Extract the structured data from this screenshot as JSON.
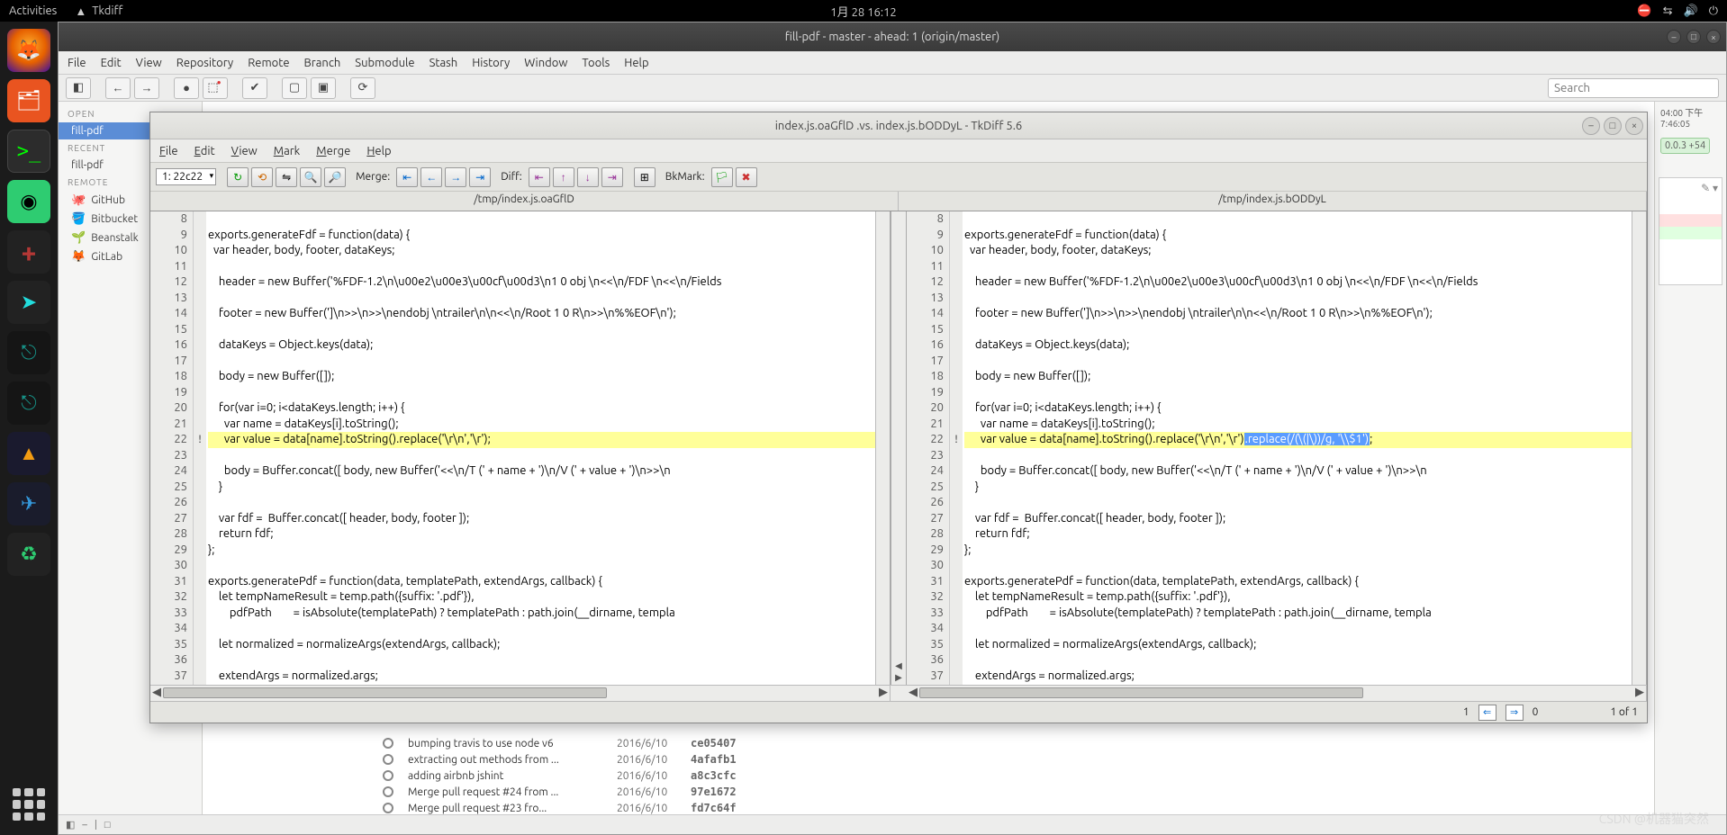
{
  "gnome": {
    "activities": "Activities",
    "app_name": "Tkdiff",
    "clock": "1月 28 16:12"
  },
  "git_window": {
    "title": "fill-pdf - master - ahead: 1 (origin/master)",
    "menus": [
      "File",
      "Edit",
      "View",
      "Repository",
      "Remote",
      "Branch",
      "Submodule",
      "Stash",
      "History",
      "Window",
      "Tools",
      "Help"
    ],
    "search_placeholder": "Search",
    "sidebar": {
      "sections": {
        "open": "OPEN",
        "recent": "RECENT",
        "remote": "REMOTE"
      },
      "open_items": [
        "fill-pdf"
      ],
      "recent_items": [
        "fill-pdf"
      ],
      "remote_items": [
        "GitHub",
        "Bitbucket",
        "Beanstalk",
        "GitLab"
      ]
    },
    "right": {
      "time": "04:00 下午7:46:05",
      "badge": "0.0.3 +54"
    },
    "commits": [
      {
        "msg": "bumping travis to use node v6",
        "date": "2016/6/10",
        "sha": "ce05407"
      },
      {
        "msg": "extracting out methods from ...",
        "date": "2016/6/10",
        "sha": "4afafb1"
      },
      {
        "msg": "adding airbnb jshint",
        "date": "2016/6/10",
        "sha": "a8c3cfc"
      },
      {
        "msg": "Merge pull request #24 from ...",
        "date": "2016/6/10",
        "sha": "97e1672"
      },
      {
        "msg": "Merge pull request #23 fro...",
        "date": "2016/6/10",
        "sha": "fd7c64f"
      }
    ]
  },
  "tkdiff": {
    "title": "index.js.oaGflD .vs. index.js.bODDyL - TkDiff 5.6",
    "menus": [
      "File",
      "Edit",
      "View",
      "Mark",
      "Merge",
      "Help"
    ],
    "change_selector": "1: 22c22",
    "toolbar_labels": {
      "merge": "Merge:",
      "diff": "Diff:",
      "bkmark": "BkMark:"
    },
    "left_path": "/tmp/index.js.oaGflD",
    "right_path": "/tmp/index.js.bODDyL",
    "left_lines": [
      {
        "n": 8,
        "t": ""
      },
      {
        "n": 9,
        "t": "exports.generateFdf = function(data) {"
      },
      {
        "n": 10,
        "t": "  var header, body, footer, dataKeys;"
      },
      {
        "n": 11,
        "t": ""
      },
      {
        "n": 12,
        "t": "    header = new Buffer('%FDF-1.2\\n\\u00e2\\u00e3\\u00cf\\u00d3\\n1 0 obj \\n<<\\n/FDF \\n<<\\n/Fields"
      },
      {
        "n": 13,
        "t": ""
      },
      {
        "n": 14,
        "t": "    footer = new Buffer(']\\n>>\\n>>\\nendobj \\ntrailer\\n\\n<<\\n/Root 1 0 R\\n>>\\n%%EOF\\n');"
      },
      {
        "n": 15,
        "t": ""
      },
      {
        "n": 16,
        "t": "    dataKeys = Object.keys(data);"
      },
      {
        "n": 17,
        "t": ""
      },
      {
        "n": 18,
        "t": "    body = new Buffer([]);"
      },
      {
        "n": 19,
        "t": ""
      },
      {
        "n": 20,
        "t": "    for(var i=0; i<dataKeys.length; i++) {"
      },
      {
        "n": 21,
        "t": "      var name = dataKeys[i].toString();"
      },
      {
        "n": 22,
        "t": "      var value = data[name].toString().replace('\\r\\n','\\r');",
        "chg": true
      },
      {
        "n": 23,
        "t": ""
      },
      {
        "n": 24,
        "t": "      body = Buffer.concat([ body, new Buffer('<<\\n/T (' + name + ')\\n/V (' + value + ')\\n>>\\n"
      },
      {
        "n": 25,
        "t": "    }"
      },
      {
        "n": 26,
        "t": ""
      },
      {
        "n": 27,
        "t": "    var fdf =  Buffer.concat([ header, body, footer ]);"
      },
      {
        "n": 28,
        "t": "    return fdf;"
      },
      {
        "n": 29,
        "t": "};"
      },
      {
        "n": 30,
        "t": ""
      },
      {
        "n": 31,
        "t": "exports.generatePdf = function(data, templatePath, extendArgs, callback) {"
      },
      {
        "n": 32,
        "t": "    let tempNameResult = temp.path({suffix: '.pdf'}),"
      },
      {
        "n": 33,
        "t": "        pdfPath        = isAbsolute(templatePath) ? templatePath : path.join(__dirname, templa"
      },
      {
        "n": 34,
        "t": ""
      },
      {
        "n": 35,
        "t": "    let normalized = normalizeArgs(extendArgs, callback);"
      },
      {
        "n": 36,
        "t": ""
      },
      {
        "n": 37,
        "t": "    extendArgs = normalized.args;"
      }
    ],
    "right_lines": [
      {
        "n": 8,
        "t": ""
      },
      {
        "n": 9,
        "t": "exports.generateFdf = function(data) {"
      },
      {
        "n": 10,
        "t": "  var header, body, footer, dataKeys;"
      },
      {
        "n": 11,
        "t": ""
      },
      {
        "n": 12,
        "t": "    header = new Buffer('%FDF-1.2\\n\\u00e2\\u00e3\\u00cf\\u00d3\\n1 0 obj \\n<<\\n/FDF \\n<<\\n/Fields"
      },
      {
        "n": 13,
        "t": ""
      },
      {
        "n": 14,
        "t": "    footer = new Buffer(']\\n>>\\n>>\\nendobj \\ntrailer\\n\\n<<\\n/Root 1 0 R\\n>>\\n%%EOF\\n');"
      },
      {
        "n": 15,
        "t": ""
      },
      {
        "n": 16,
        "t": "    dataKeys = Object.keys(data);"
      },
      {
        "n": 17,
        "t": ""
      },
      {
        "n": 18,
        "t": "    body = new Buffer([]);"
      },
      {
        "n": 19,
        "t": ""
      },
      {
        "n": 20,
        "t": "    for(var i=0; i<dataKeys.length; i++) {"
      },
      {
        "n": 21,
        "t": "      var name = dataKeys[i].toString();"
      },
      {
        "n": 22,
        "t": "      var value = data[name].toString().replace('\\r\\n','\\r')",
        "chg": true,
        "add": ".replace(/(\\(|\\))/g, '\\\\$1')",
        "tail": ";"
      },
      {
        "n": 23,
        "t": ""
      },
      {
        "n": 24,
        "t": "      body = Buffer.concat([ body, new Buffer('<<\\n/T (' + name + ')\\n/V (' + value + ')\\n>>\\n"
      },
      {
        "n": 25,
        "t": "    }"
      },
      {
        "n": 26,
        "t": ""
      },
      {
        "n": 27,
        "t": "    var fdf =  Buffer.concat([ header, body, footer ]);"
      },
      {
        "n": 28,
        "t": "    return fdf;"
      },
      {
        "n": 29,
        "t": "};"
      },
      {
        "n": 30,
        "t": ""
      },
      {
        "n": 31,
        "t": "exports.generatePdf = function(data, templatePath, extendArgs, callback) {"
      },
      {
        "n": 32,
        "t": "    let tempNameResult = temp.path({suffix: '.pdf'}),"
      },
      {
        "n": 33,
        "t": "        pdfPath        = isAbsolute(templatePath) ? templatePath : path.join(__dirname, templa"
      },
      {
        "n": 34,
        "t": ""
      },
      {
        "n": 35,
        "t": "    let normalized = normalizeArgs(extendArgs, callback);"
      },
      {
        "n": 36,
        "t": ""
      },
      {
        "n": 37,
        "t": "    extendArgs = normalized.args;"
      }
    ],
    "footer": {
      "nav_left": "1",
      "nav_right": "0",
      "counter": "1 of 1"
    }
  },
  "watermark": "CSDN @机器猫突然"
}
